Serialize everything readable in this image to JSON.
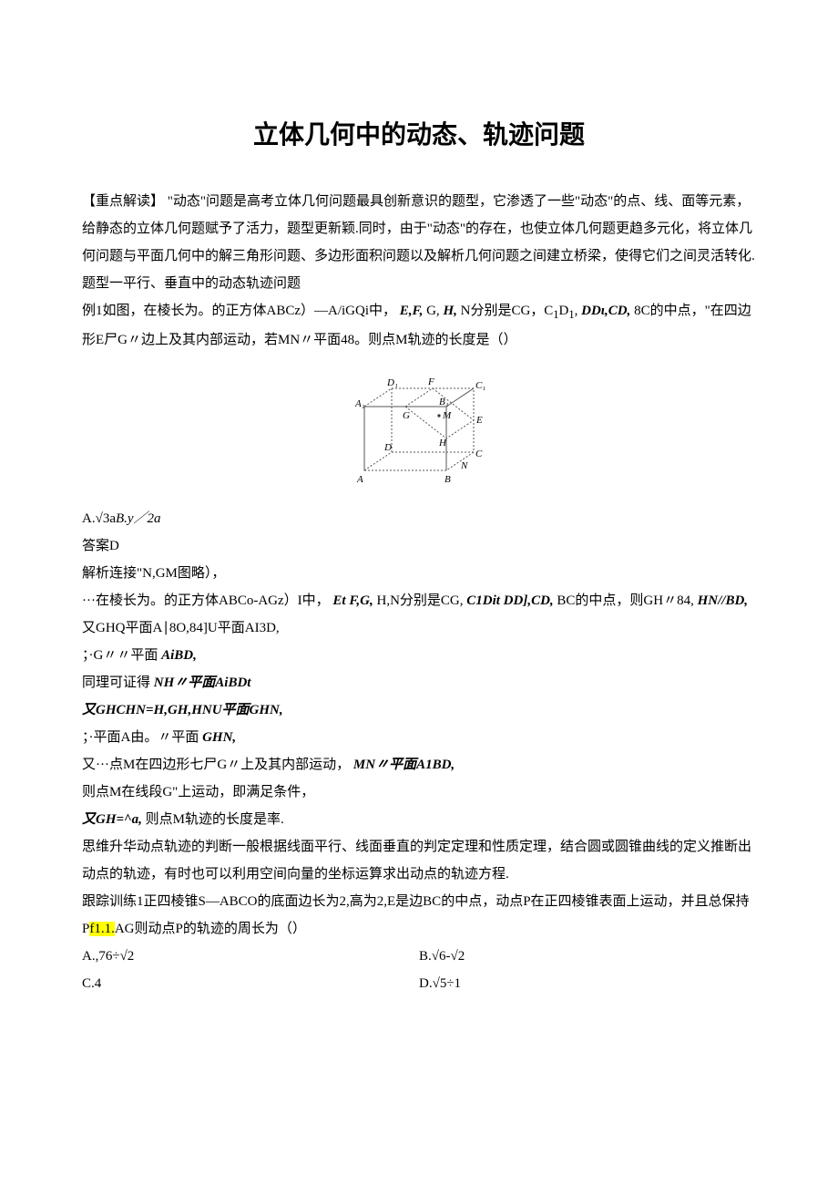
{
  "title": "立体几何中的动态、轨迹问题",
  "intro1": "【重点解读】 \"动态\"问题是高考立体几何问题最具创新意识的题型，它渗透了一些\"动态\"的点、线、面等元素，给静态的立体几何题赋予了活力，题型更新颖.同时，由于\"动态\"的存在，也使立体几何题更趋多元化，将立体几何问题与平面几何中的解三角形问题、多边形面积问题以及解析几何问题之间建立桥梁，使得它们之间灵活转化.",
  "section1": "题型一平行、垂直中的动态轨迹问题",
  "ex1_prefix": "例1如图，在棱长为。的正方体ABCz）—A/iGQi中，",
  "ex1_italic1": "E,F,",
  "ex1_mid1": "G,",
  "ex1_italic2": "H,",
  "ex1_mid2": "N分别是CG，C",
  "ex1_sub1": "1",
  "ex1_mid3": "D",
  "ex1_sub2": "1",
  "ex1_mid4": ",",
  "ex1_italic3": "DDι,CD,",
  "ex1_mid5": "8C的中点，\"在四边形E尸G〃边上及其内部运动，若MN〃平面48。则点M轨迹的长度是（）",
  "optA": "A.√3a",
  "optA_italic": "B.y／2a",
  "ans1": "答案D",
  "sol1": "解析连接\"N,GM图略），",
  "sol2_a": "···在棱长为。的正方体ABCo-AGz）I中，",
  "sol2_italic": "Et F,G,",
  "sol2_b": "H,N分别是CG,",
  "sol2_italic2": "C1Dit DD],CD,",
  "sol2_c": "BC的中点，则GH〃84,",
  "sol2_italic3": "HN//BD,",
  "sol3": "又GHQ平面A∣8O,84]U平面AI3D,",
  "sol4_a": "；·G〃〃平面",
  "sol4_italic": "AiBD,",
  "sol5_a": "同理可证得",
  "sol5_italic": "NH〃平面AiBDt",
  "sol6_italic": "又GHCHN=H,GH,HNU平面GHN,",
  "sol7_a": "；·平面A由。〃平面",
  "sol7_italic": "GHN,",
  "sol8_a": "又···点M在四边形七尸G〃上及其内部运动，",
  "sol8_italic": "MN〃平面A1BD,",
  "sol9": "则点M在线段G\"上运动，即满足条件，",
  "sol10_italic": "又GH=^a,",
  "sol10_b": "则点M轨迹的长度是率.",
  "summary": "思维升华动点轨迹的判断一般根据线面平行、线面垂直的判定定理和性质定理，结合圆或圆锥曲线的定义推断出动点的轨迹，有时也可以利用空间向量的坐标运算求出动点的轨迹方程.",
  "track1_a": "跟踪训练1正四棱锥S—ABCO的底面边长为2,高为2,E是边BC的中点，动点P在正四棱锥表面上运动，并且总保持P",
  "track1_hl": "f1.1.",
  "track1_b": "AG则动点P的轨迹的周长为（）",
  "tA": "A.,76÷√2",
  "tB": "B.√6-√2",
  "tC": "C.4",
  "tD": "D.√5÷1"
}
